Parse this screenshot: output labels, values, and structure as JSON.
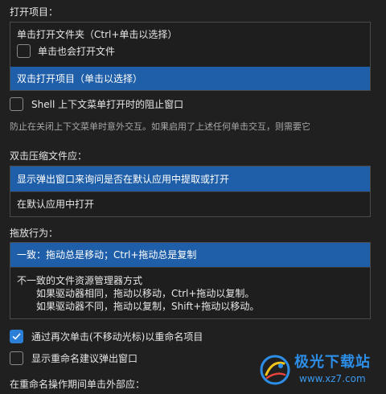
{
  "open_item": {
    "label": "打开项目：",
    "options": [
      {
        "label": "单击打开文件夹（Ctrl+单击以选择）",
        "sub_checkbox": {
          "label": "单击也会打开文件",
          "checked": false
        }
      },
      {
        "label": "双击打开项目（单击以选择）",
        "selected": true
      }
    ]
  },
  "shell_block": {
    "label": "Shell 上下文菜单打开时的阻止窗口",
    "checked": false,
    "description": "防止在关闭上下文菜单时意外交互。如果启用了上述任何单击交互，则需要它"
  },
  "double_click_archive": {
    "label": "双击压缩文件应：",
    "options": [
      {
        "label": "显示弹出窗口来询问是否在默认应用中提取或打开",
        "selected": true
      },
      {
        "label": "在默认应用中打开",
        "selected": false
      }
    ]
  },
  "drag_behavior": {
    "label": "拖放行为：",
    "options": [
      {
        "label": "一致：拖动总是移动；Ctrl+拖动总是复制",
        "selected": true
      },
      {
        "label": "不一致的文件资源管理器方式",
        "lines": [
          "如果驱动器相同，拖动以移动，Ctrl+拖动以复制。",
          "如果驱动器不同，拖动以复制，Shift+拖动以移动。"
        ],
        "selected": false
      }
    ]
  },
  "rename_click": {
    "label": "通过再次单击(不移动光标)以重命名项目",
    "checked": true
  },
  "rename_popup": {
    "label": "显示重命名建议弹出窗口",
    "checked": false
  },
  "rename_outside": {
    "label": "在重命名操作期间单击外部应："
  },
  "watermark": {
    "title": "极光下载站",
    "url": "www.xz7.com"
  },
  "colors": {
    "background": "#202020",
    "selected": "#1f5ea8",
    "checked": "#2b7fd6",
    "watermark": "#2d8ee8"
  }
}
